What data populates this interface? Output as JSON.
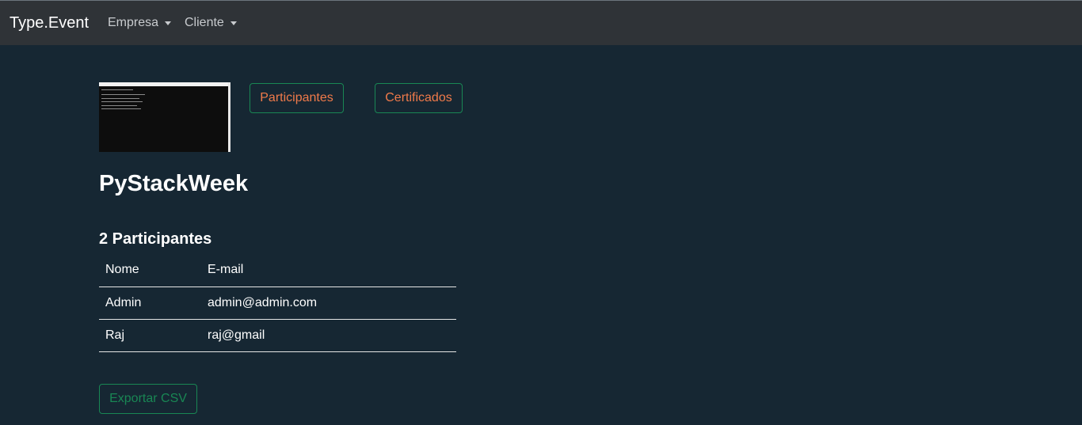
{
  "navbar": {
    "brand": "Type.Event",
    "menus": [
      {
        "label": "Empresa"
      },
      {
        "label": "Cliente"
      }
    ]
  },
  "event": {
    "title": "PyStackWeek",
    "thumbnail_icon": "terminal-screenshot-thumbnail"
  },
  "actions": {
    "participants_label": "Participantes",
    "certificates_label": "Certificados",
    "export_label": "Exportar CSV"
  },
  "participants": {
    "count_label": "2 Participantes",
    "columns": [
      "Nome",
      "E-mail"
    ],
    "rows": [
      {
        "name": "Admin",
        "email": "admin@admin.com"
      },
      {
        "name": "Raj",
        "email": "raj@gmail"
      }
    ]
  },
  "colors": {
    "navbar_bg": "#2f3337",
    "page_bg": "#162733",
    "accent_orange": "#f07a4a",
    "accent_green": "#198754"
  }
}
